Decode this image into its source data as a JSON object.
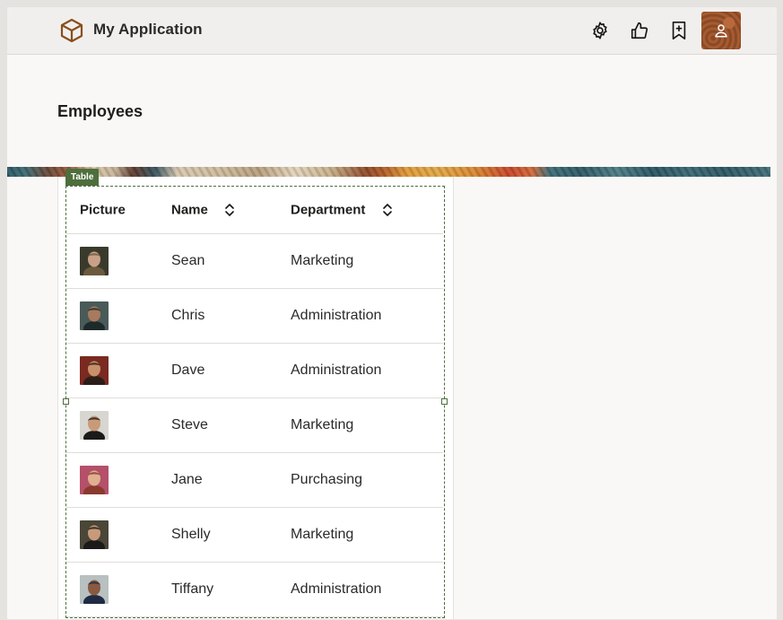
{
  "app": {
    "title": "My Application"
  },
  "header": {
    "icons": [
      "settings-icon",
      "thumbs-up-icon",
      "bookmark-add-icon",
      "user-icon"
    ]
  },
  "page": {
    "title": "Employees"
  },
  "table": {
    "badge": "Table",
    "columns": [
      "Picture",
      "Name",
      "Department"
    ],
    "rows": [
      {
        "name": "Sean",
        "department": "Marketing",
        "picture_colors": [
          "#3a3a2c",
          "#c9a187",
          "#6b5a3e"
        ]
      },
      {
        "name": "Chris",
        "department": "Administration",
        "picture_colors": [
          "#4a5a58",
          "#a87a5e",
          "#1e2a2a"
        ]
      },
      {
        "name": "Dave",
        "department": "Administration",
        "picture_colors": [
          "#7a2a20",
          "#c8906a",
          "#2b1e18"
        ]
      },
      {
        "name": "Steve",
        "department": "Marketing",
        "picture_colors": [
          "#d8d6d0",
          "#c99a78",
          "#1a1a1a"
        ]
      },
      {
        "name": "Jane",
        "department": "Purchasing",
        "picture_colors": [
          "#b4506a",
          "#e0b090",
          "#8a3a2e"
        ]
      },
      {
        "name": "Shelly",
        "department": "Marketing",
        "picture_colors": [
          "#4a4638",
          "#c89a7a",
          "#1c1a18"
        ]
      },
      {
        "name": "Tiffany",
        "department": "Administration",
        "picture_colors": [
          "#b8c0c0",
          "#8a5a40",
          "#1f2a44"
        ]
      }
    ]
  },
  "colors": {
    "accent": "#4e6f3d",
    "header_bg": "#f1efed",
    "page_bg": "#f9f8f6"
  }
}
